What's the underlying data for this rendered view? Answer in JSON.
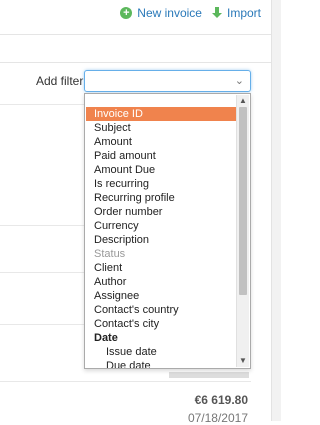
{
  "header": {
    "new_invoice_label": "New invoice",
    "import_label": "Import"
  },
  "filter": {
    "label": "Add filter",
    "current_value": "",
    "options": [
      {
        "label": "Invoice ID",
        "state": "selected"
      },
      {
        "label": "Subject",
        "state": "normal"
      },
      {
        "label": "Amount",
        "state": "normal"
      },
      {
        "label": "Paid amount",
        "state": "normal"
      },
      {
        "label": "Amount Due",
        "state": "normal"
      },
      {
        "label": "Is recurring",
        "state": "normal"
      },
      {
        "label": "Recurring profile",
        "state": "normal"
      },
      {
        "label": "Order number",
        "state": "normal"
      },
      {
        "label": "Currency",
        "state": "normal"
      },
      {
        "label": "Description",
        "state": "normal"
      },
      {
        "label": "Status",
        "state": "disabled"
      },
      {
        "label": "Client",
        "state": "normal"
      },
      {
        "label": "Author",
        "state": "normal"
      },
      {
        "label": "Assignee",
        "state": "normal"
      },
      {
        "label": "Contact's country",
        "state": "normal"
      },
      {
        "label": "Contact's city",
        "state": "normal"
      },
      {
        "label": "Date",
        "state": "group"
      },
      {
        "label": "Issue date",
        "state": "sub"
      },
      {
        "label": "Due date",
        "state": "sub"
      }
    ]
  },
  "row": {
    "amount": "€6 619.80",
    "date": "07/18/2017"
  },
  "colors": {
    "accent_link": "#2a79b9",
    "selected_option": "#f0834d",
    "add_icon": "#5cb85c",
    "import_icon": "#5cb85c"
  },
  "icons": {
    "add": "plus-circle-icon",
    "import": "download-arrow-icon",
    "caret": "chevron-down-icon"
  }
}
